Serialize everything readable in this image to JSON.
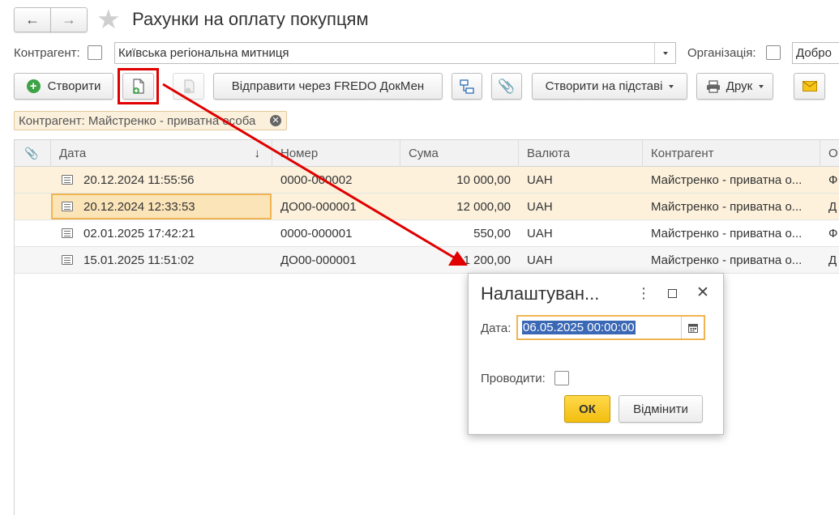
{
  "window": {
    "title": "Рахунки на оплату покупцям",
    "nav_back": "←",
    "nav_forward": "→",
    "favorite": "★"
  },
  "filters": {
    "counterparty_label": "Контрагент:",
    "counterparty_value": "Київська регіональна митниця",
    "organization_label": "Організація:",
    "organization_value": "Добро"
  },
  "toolbar": {
    "create_label": "Створити",
    "send_fredo_label": "Відправити через FREDO ДокМен",
    "create_based_label": "Створити на підставі",
    "print_label": "Друк"
  },
  "filter_chip": {
    "label": "Контрагент: Майстренко - приватна особа"
  },
  "table": {
    "columns": [
      "Дата",
      "Номер",
      "Сума",
      "Валюта",
      "Контрагент",
      "О"
    ],
    "sort_indicator": "↓",
    "rows": [
      {
        "date": "20.12.2024 11:55:56",
        "number": "0000-000002",
        "sum": "10 000,00",
        "currency": "UAH",
        "counterparty": "Майстренко - приватна о...",
        "org": "Ф"
      },
      {
        "date": "20.12.2024 12:33:53",
        "number": "ДО00-000001",
        "sum": "12 000,00",
        "currency": "UAH",
        "counterparty": "Майстренко - приватна о...",
        "org": "Д"
      },
      {
        "date": "02.01.2025 17:42:21",
        "number": "0000-000001",
        "sum": "550,00",
        "currency": "UAH",
        "counterparty": "Майстренко - приватна о...",
        "org": "Ф"
      },
      {
        "date": "15.01.2025 11:51:02",
        "number": "ДО00-000001",
        "sum": "1 200,00",
        "currency": "UAH",
        "counterparty": "Майстренко - приватна о...",
        "org": "Д"
      }
    ]
  },
  "dialog": {
    "title": "Налаштуван...",
    "date_label": "Дата:",
    "date_value": "06.05.2025 00:00:00",
    "post_label": "Проводити:",
    "ok_label": "ОК",
    "cancel_label": "Відмінити"
  },
  "colors": {
    "highlight_red": "#e00000",
    "selected_row": "#fdf1dc",
    "accent_yellow": "#f5c518",
    "chip_bg": "#fbf0dc"
  }
}
